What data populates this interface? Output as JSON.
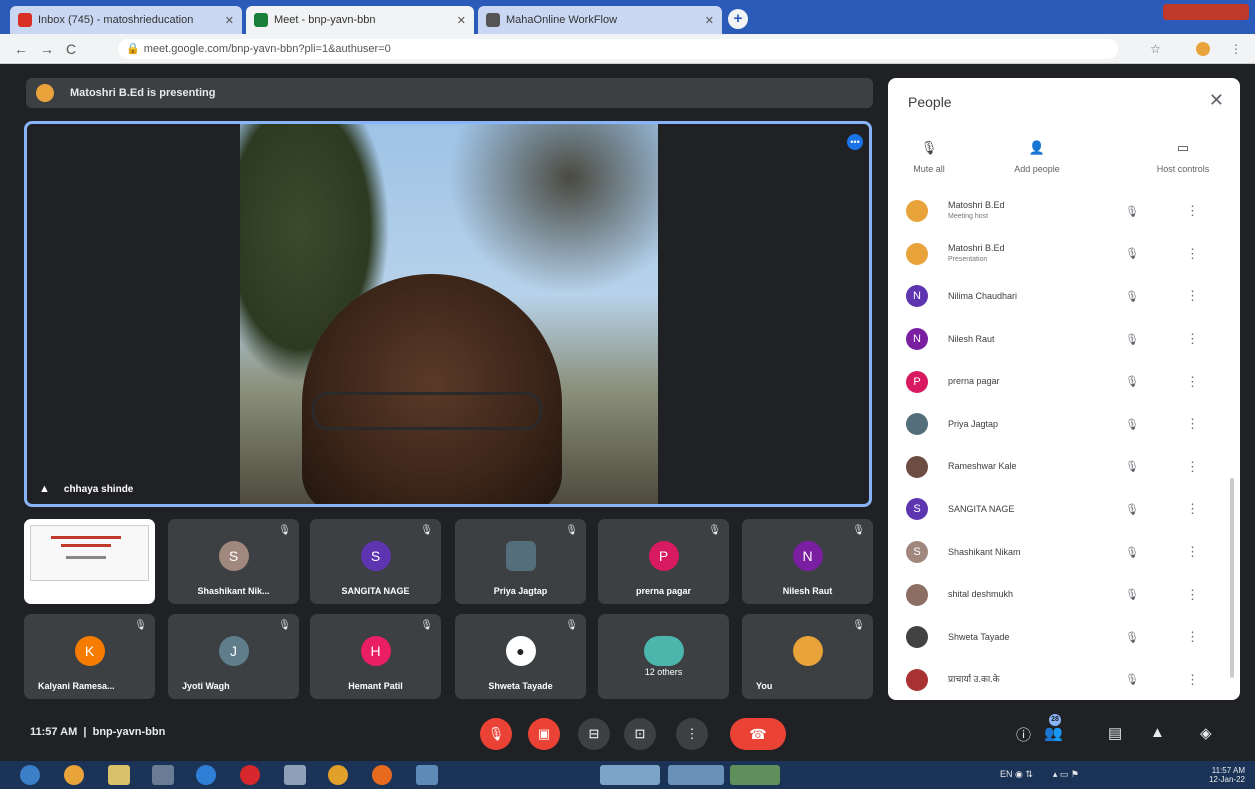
{
  "browser": {
    "tabs": [
      {
        "label": "Inbox (745) - matoshrieducation",
        "color": "#d93025"
      },
      {
        "label": "Meet - bnp-yavn-bbn",
        "color": "#188038"
      },
      {
        "label": "MahaOnline WorkFlow",
        "color": "#555555"
      }
    ],
    "url": "meet.google.com/bnp-yavn-bbn?pli=1&authuser=0",
    "back_icon": "←",
    "forward_icon": "→",
    "reload_icon": "C",
    "star_icon": "☆",
    "newtab_icon": "+"
  },
  "meet": {
    "presenting_banner": "Matoshri B.Ed is presenting",
    "main_speaker": "chhaya shinde",
    "tiles_row1": [
      {
        "name": "",
        "type": "slide"
      },
      {
        "name": "Shashikant Nik...",
        "initial": "S",
        "color": "#a1887f"
      },
      {
        "name": "SANGITA NAGE",
        "initial": "S",
        "color": "#5e35b1"
      },
      {
        "name": "Priya Jagtap",
        "initial": "",
        "color": "#546e7a",
        "type": "photo"
      },
      {
        "name": "prerna pagar",
        "initial": "P",
        "color": "#d81b60"
      },
      {
        "name": "Nilesh Raut",
        "initial": "N",
        "color": "#7b1fa2"
      }
    ],
    "tiles_row2": [
      {
        "name": "Kalyani Ramesa...",
        "initial": "K",
        "color": "#f57c00"
      },
      {
        "name": "Jyoti Wagh",
        "initial": "J",
        "color": "#607d8b"
      },
      {
        "name": "Hemant Patil",
        "initial": "H",
        "color": "#e91e63"
      },
      {
        "name": "Shweta Tayade",
        "initial": "",
        "color": "#ffffff",
        "type": "photo"
      },
      {
        "name": "12 others",
        "initial": "",
        "color": "#4db6ac",
        "type": "others"
      },
      {
        "name": "You",
        "initial": "",
        "color": "#e8a33a",
        "type": "you"
      }
    ],
    "clock": "11:57 AM",
    "meeting_code": "bnp-yavn-bbn"
  },
  "people_panel": {
    "title": "People",
    "actions": [
      {
        "label": "Mute all",
        "icon": "mic-off"
      },
      {
        "label": "Add people",
        "icon": "person-add"
      },
      {
        "label": "Host controls",
        "icon": "toggle"
      }
    ],
    "participants": [
      {
        "name": "Matoshri B.Ed",
        "sub": "Meeting host",
        "color": "#e8a33a",
        "initial": ""
      },
      {
        "name": "Matoshri B.Ed",
        "sub": "Presentation",
        "color": "#e8a33a",
        "initial": ""
      },
      {
        "name": "Nilima Chaudhari",
        "sub": "",
        "color": "#5e35b1",
        "initial": "N"
      },
      {
        "name": "Nilesh Raut",
        "sub": "",
        "color": "#7b1fa2",
        "initial": "N"
      },
      {
        "name": "prerna pagar",
        "sub": "",
        "color": "#d81b60",
        "initial": "P"
      },
      {
        "name": "Priya Jagtap",
        "sub": "",
        "color": "#546e7a",
        "initial": ""
      },
      {
        "name": "Rameshwar Kale",
        "sub": "",
        "color": "#6d4c41",
        "initial": ""
      },
      {
        "name": "SANGITA NAGE",
        "sub": "",
        "color": "#5e35b1",
        "initial": "S"
      },
      {
        "name": "Shashikant Nikam",
        "sub": "",
        "color": "#a1887f",
        "initial": "S"
      },
      {
        "name": "shital deshmukh",
        "sub": "",
        "color": "#8d6e63",
        "initial": ""
      },
      {
        "name": "Shweta Tayade",
        "sub": "",
        "color": "#424242",
        "initial": ""
      },
      {
        "name": "प्राचार्या उ.का.के",
        "sub": "",
        "color": "#a83232",
        "initial": ""
      }
    ]
  },
  "bottom_badge": "28",
  "taskbar": {
    "time": "11:57 AM",
    "date": "12-Jan-22"
  }
}
